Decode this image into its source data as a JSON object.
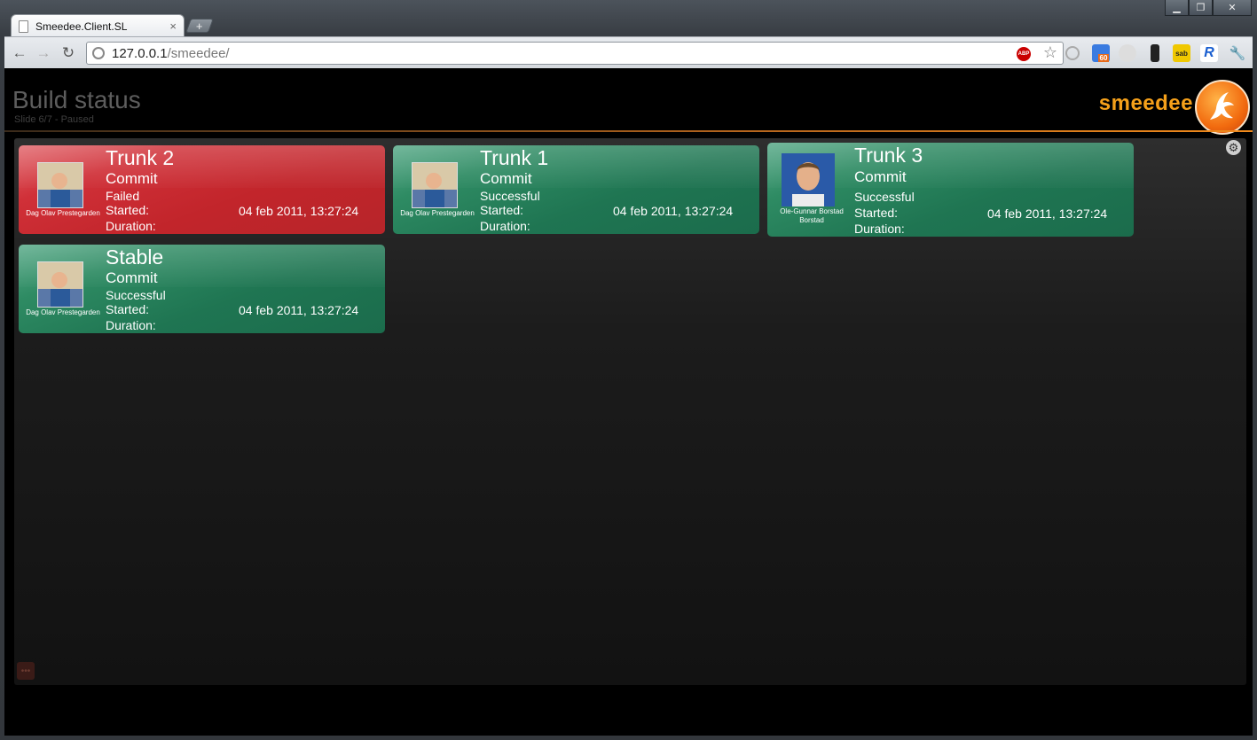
{
  "browser": {
    "tab_title": "Smeedee.Client.SL",
    "tab_close": "×",
    "new_tab": "+",
    "url_host": "127.0.0.1",
    "url_path": "/smeedee/",
    "back": "←",
    "forward": "→",
    "reload": "↻",
    "abp": "ABP",
    "star": "☆",
    "ext_badge": "60",
    "ext_sab": "sab",
    "ext_r": "R",
    "wrench": "🔧",
    "minimize": "▁",
    "maximize": "❐",
    "close": "✕"
  },
  "header": {
    "title": "Build status",
    "subtitle": "Slide 6/7 - Paused",
    "logo_text": "smeedee"
  },
  "builds": [
    {
      "name": "Trunk 2",
      "stage": "Commit",
      "status": "Failed",
      "started_label": "Started:",
      "started_value": "04 feb 2011, 13:27:24",
      "duration_label": "Duration:",
      "user_line1": "Dag Olav  Prestegarden",
      "user_line2": "",
      "state": "failed"
    },
    {
      "name": "Trunk 1",
      "stage": "Commit",
      "status": "Successful",
      "started_label": "Started:",
      "started_value": "04 feb 2011, 13:27:24",
      "duration_label": "Duration:",
      "user_line1": "Dag Olav  Prestegarden",
      "user_line2": "",
      "state": "success"
    },
    {
      "name": "Trunk 3",
      "stage": "Commit",
      "status": "Successful",
      "started_label": "Started:",
      "started_value": "04 feb 2011, 13:27:24",
      "duration_label": "Duration:",
      "user_line1": "Ole-Gunnar  Borstad",
      "user_line2": "Borstad",
      "state": "success"
    },
    {
      "name": "Stable",
      "stage": "Commit",
      "status": "Successful",
      "started_label": "Started:",
      "started_value": "04 feb 2011, 13:27:24",
      "duration_label": "Duration:",
      "user_line1": "Dag Olav  Prestegarden",
      "user_line2": "",
      "state": "success"
    }
  ],
  "colors": {
    "failed": "#c8282e",
    "success": "#217a56",
    "logo_orange": "#f5a01a"
  },
  "icons": {
    "settings": "gear-icon",
    "corner": "menu-icon"
  },
  "settings_glyph": "⚙",
  "corner_glyph": "•••"
}
